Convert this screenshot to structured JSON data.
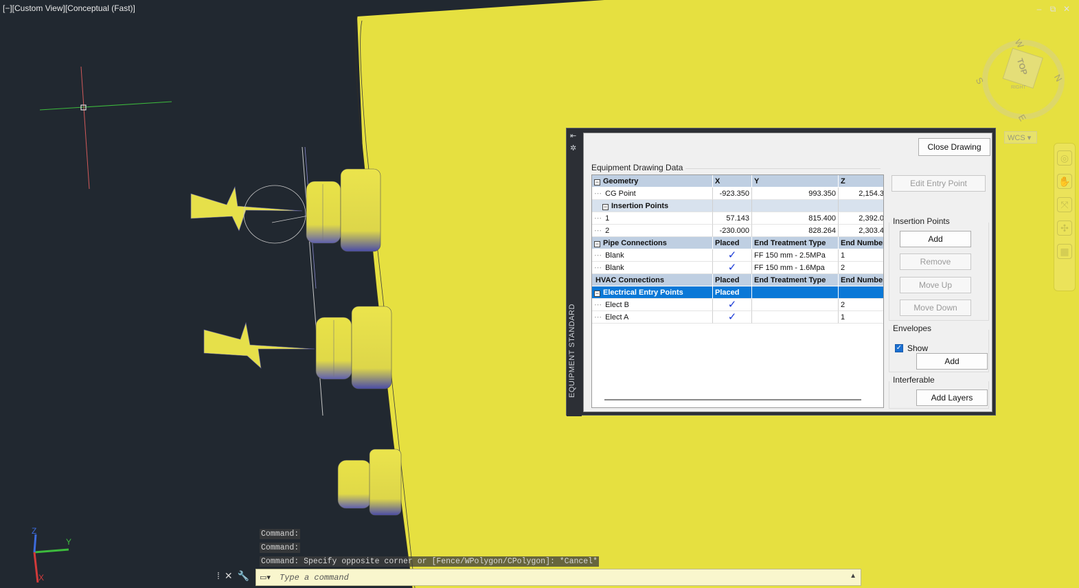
{
  "viewport": {
    "label": "[−][Custom View][Conceptual (Fast)]",
    "window_controls": [
      "‒",
      "⧉",
      "✕"
    ],
    "viewcube": {
      "face": "TOP",
      "sub_face": "RIGHT",
      "compass": [
        "W",
        "N",
        "S",
        "E"
      ]
    },
    "wcs_label": "WCS",
    "colors": {
      "background": "#212830",
      "equipment": "#e6e040",
      "accent": "#0a78d7"
    }
  },
  "panel": {
    "side_title": "EQUIPMENT STANDARD",
    "close_button": "Close Drawing",
    "section_title": "Equipment Drawing Data",
    "grid": {
      "rows": [
        {
          "type": "hdr",
          "toggle": "⊟",
          "c0": "Geometry",
          "c1": "X",
          "c2": "Y",
          "c3": "Z"
        },
        {
          "type": "data",
          "c0": "CG Point",
          "c1": "-923.350",
          "c2": "993.350",
          "c3": "2,154.3"
        },
        {
          "type": "sub",
          "toggle": "⊟",
          "c0": "Insertion Points",
          "c1": "",
          "c2": "",
          "c3": ""
        },
        {
          "type": "data2",
          "c0": "1",
          "c1": "57.143",
          "c2": "815.400",
          "c3": "2,392.0"
        },
        {
          "type": "data2",
          "c0": "2",
          "c1": "-230.000",
          "c2": "828.264",
          "c3": "2,303.4"
        },
        {
          "type": "hdr",
          "toggle": "⊟",
          "c0": "Pipe Connections",
          "c1": "Placed",
          "c2": "End Treatment Type",
          "c3": "End Number"
        },
        {
          "type": "check",
          "c0": "Blank",
          "c2": "FF 150 mm - 2.5MPa",
          "c3": "1"
        },
        {
          "type": "check",
          "c0": "Blank",
          "c2": "FF 150 mm - 1.6Mpa",
          "c3": "2"
        },
        {
          "type": "hdr",
          "c0": "HVAC Connections",
          "c1": "Placed",
          "c2": "End Treatment Type",
          "c3": "End Number"
        },
        {
          "type": "sel",
          "toggle": "⊟",
          "c0": "Electrical Entry Points",
          "c1": "Placed",
          "c2": "",
          "c3": ""
        },
        {
          "type": "check",
          "c0": "Elect B",
          "c2": "",
          "c3": "2"
        },
        {
          "type": "check",
          "c0": "Elect A",
          "c2": "",
          "c3": "1"
        }
      ]
    },
    "right": {
      "edit_entry_point": "Edit Entry Point",
      "insertion_points_title": "Insertion Points",
      "add": "Add",
      "remove": "Remove",
      "move_up": "Move Up",
      "move_down": "Move Down",
      "envelopes_title": "Envelopes",
      "show_label": "Show",
      "show_checked": true,
      "envelopes_add": "Add",
      "interferable_title": "Interferable",
      "add_layers": "Add Layers"
    }
  },
  "command": {
    "history": [
      "Command:",
      "Command:",
      "Command: Specify opposite corner or [Fence/WPolygon/CPolygon]: *Cancel*"
    ],
    "placeholder": "Type a command"
  },
  "ucs": {
    "x": "X",
    "y": "Y",
    "z": "Z"
  }
}
